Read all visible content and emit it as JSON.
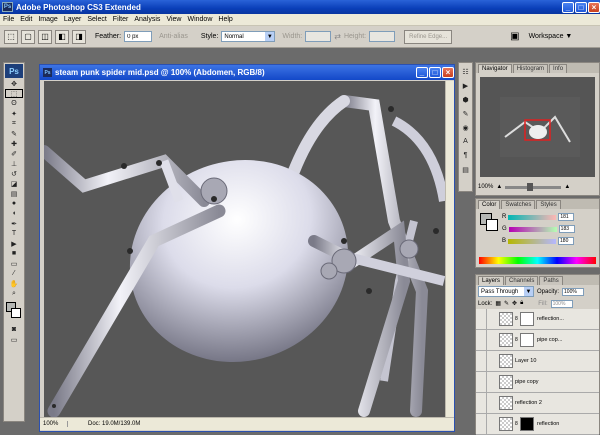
{
  "app": {
    "title": "Adobe Photoshop CS3 Extended",
    "logo": "Ps"
  },
  "menu": [
    "File",
    "Edit",
    "Image",
    "Layer",
    "Select",
    "Filter",
    "Analysis",
    "View",
    "Window",
    "Help"
  ],
  "options": {
    "feather_label": "Feather:",
    "feather_value": "0 px",
    "antialias_label": "Anti-alias",
    "style_label": "Style:",
    "style_value": "Normal",
    "width_label": "Width:",
    "height_label": "Height:",
    "refine_label": "Refine Edge...",
    "workspace_label": "Workspace ▼"
  },
  "document": {
    "title": "steam punk spider mid.psd @ 100% (Abdomen, RGB/8)",
    "zoom": "100%",
    "doc_info": "Doc: 19.0M/139.0M"
  },
  "navigator": {
    "tabs": [
      "Navigator",
      "Histogram",
      "Info"
    ],
    "zoom": "100%"
  },
  "color": {
    "tabs": [
      "Color",
      "Swatches",
      "Styles"
    ],
    "channels": [
      {
        "name": "R",
        "value": "181"
      },
      {
        "name": "G",
        "value": "183"
      },
      {
        "name": "B",
        "value": "180"
      }
    ]
  },
  "layers": {
    "tabs": [
      "Layers",
      "Channels",
      "Paths"
    ],
    "blend_mode": "Pass Through",
    "opacity_label": "Opacity:",
    "opacity_value": "100%",
    "lock_label": "Lock:",
    "fill_label": "Fill:",
    "fill_value": "100%",
    "items": [
      {
        "name": "reflection...",
        "mask": "white"
      },
      {
        "name": "pipe cop...",
        "mask": "white"
      },
      {
        "name": "Layer 10",
        "mask": "none"
      },
      {
        "name": "pipe copy",
        "mask": "none"
      },
      {
        "name": "reflection 2",
        "mask": "none"
      },
      {
        "name": "reflection",
        "mask": "black"
      }
    ]
  },
  "colors": {
    "accent": "#2a63d8",
    "canvas": "#575757",
    "panel": "#d4d0c8"
  }
}
